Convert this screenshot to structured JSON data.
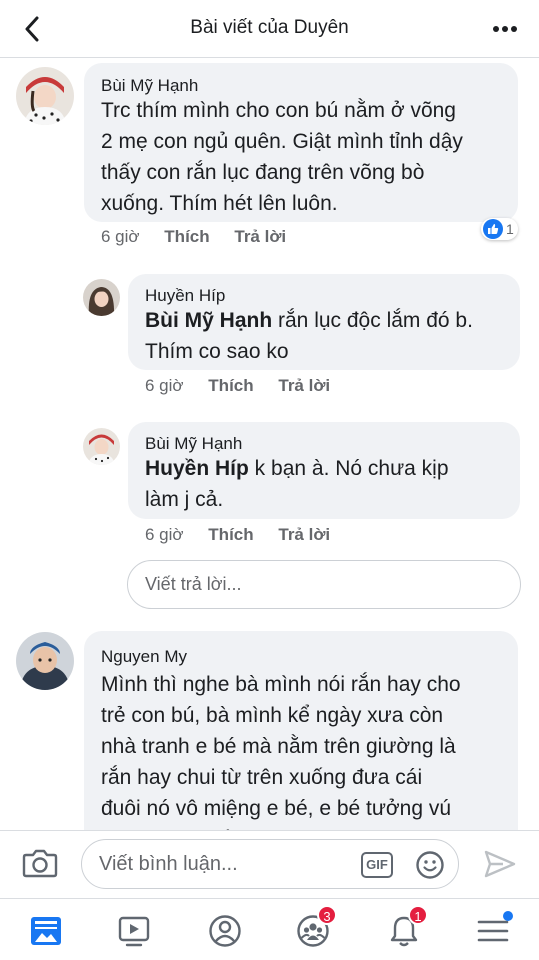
{
  "header": {
    "title": "Bài viết của Duyên"
  },
  "comments": [
    {
      "author": "Bùi Mỹ Hạnh",
      "text_lines": [
        "Trc thím mình cho con bú nằm ở võng",
        "2 mẹ con ngủ quên. Giật mình tỉnh dậy",
        "thấy con rắn lục đang trên võng bò",
        "xuống. Thím hét lên luôn."
      ],
      "time": "6 giờ",
      "like_label": "Thích",
      "reply_label": "Trả lời",
      "reaction_count": "1",
      "reaction_icon": "like-icon"
    },
    {
      "author": "Huyền Híp",
      "mention": "Bùi Mỹ Hạnh",
      "text_after_mention": " rắn lục độc lắm đó b.",
      "text_line2": "Thím co sao ko",
      "time": "6 giờ",
      "like_label": "Thích",
      "reply_label": "Trả lời"
    },
    {
      "author": "Bùi Mỹ Hạnh",
      "mention": "Huyền Híp",
      "text_after_mention": " k bạn à. Nó chưa kịp",
      "text_line2": "làm j cả.",
      "time": "6 giờ",
      "like_label": "Thích",
      "reply_label": "Trả lời"
    },
    {
      "author": "Nguyen My",
      "text_lines": [
        "Mình thì nghe bà mình nói rắn hay cho",
        "trẻ con bú, bà mình kể ngày xưa còn",
        "nhà tranh e bé mà nằm trên giường là",
        "rắn hay chui từ trên xuống đưa cái",
        "đuôi nó vô miệng e bé, e bé tưởng vú",
        "mẹ nên bú riết nó đưa vô tới bụng làm"
      ]
    }
  ],
  "reply_box": {
    "placeholder": "Viết trả lời..."
  },
  "composer": {
    "placeholder": "Viết bình luận...",
    "gif_label": "GIF"
  },
  "bottom_nav": {
    "friends_badge": "3",
    "notifications_badge": "1"
  },
  "colors": {
    "bubble": "#f0f2f5",
    "accent": "#1877f2",
    "badge": "#e41e3f",
    "muted_text": "#65676b"
  }
}
